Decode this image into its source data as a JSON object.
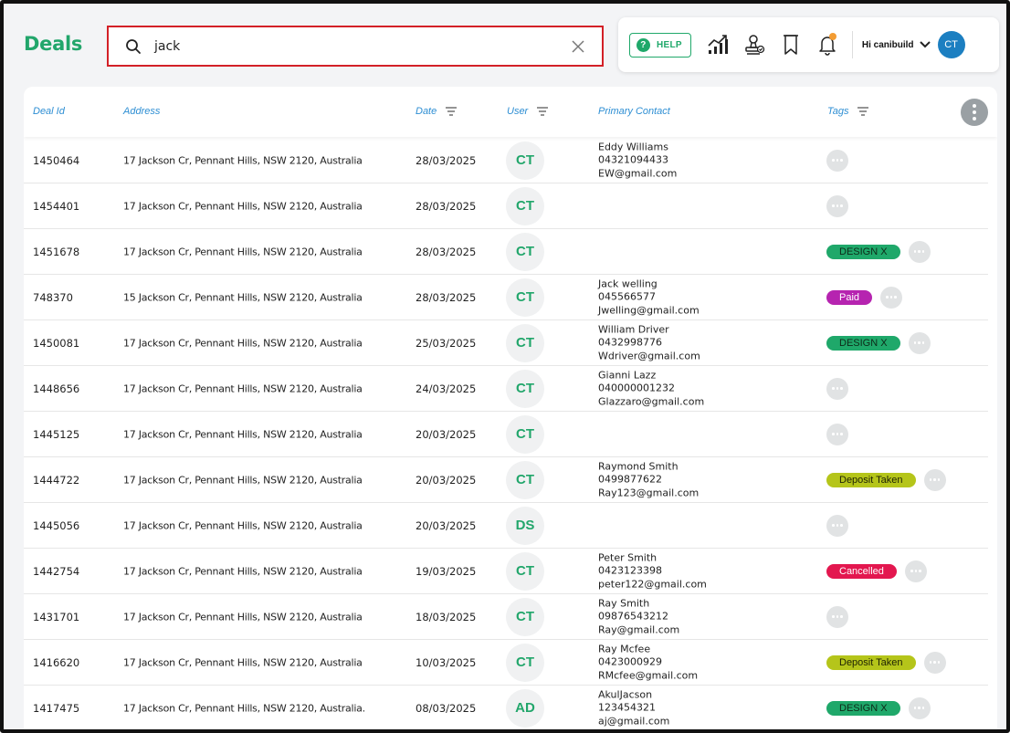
{
  "header": {
    "title": "Deals",
    "search_value": "jack",
    "help_label": "HELP",
    "greeting": "Hi canibuild",
    "user_initials": "CT"
  },
  "colors": {
    "brand_green": "#22a66b",
    "link_blue": "#2d8ed3",
    "search_border": "#d32027",
    "avatar_blue": "#1c7fc1",
    "notification_dot": "#f39c33"
  },
  "icons": {
    "search": "search-icon",
    "clear": "close-icon",
    "analytics": "chart-icon",
    "approvals": "stamp-icon",
    "bookmark": "bookmark-icon",
    "notifications": "bell-icon",
    "menu": "chevron-down-icon"
  },
  "table": {
    "columns": {
      "deal_id": "Deal Id",
      "address": "Address",
      "date": "Date",
      "user": "User",
      "primary_contact": "Primary Contact",
      "tags": "Tags"
    },
    "rows": [
      {
        "id": "1450464",
        "address": "17 Jackson Cr, Pennant Hills, NSW 2120, Australia",
        "date": "28/03/2025",
        "user": "CT",
        "contact": [
          "Eddy Williams",
          "04321094433",
          "EW@gmail.com"
        ],
        "tags": []
      },
      {
        "id": "1454401",
        "address": "17 Jackson Cr, Pennant Hills, NSW 2120, Australia",
        "date": "28/03/2025",
        "user": "CT",
        "contact": [
          "",
          "",
          ""
        ],
        "tags": []
      },
      {
        "id": "1451678",
        "address": "17 Jackson Cr, Pennant Hills, NSW 2120, Australia",
        "date": "28/03/2025",
        "user": "CT",
        "contact": [
          "",
          "",
          ""
        ],
        "tags": [
          {
            "label": "DESIGN X",
            "bg": "#1fa86a",
            "fg": "#0d2a18"
          }
        ]
      },
      {
        "id": "748370",
        "address": "15 Jackson Cr, Pennant Hills, NSW 2120, Australia",
        "date": "28/03/2025",
        "user": "CT",
        "contact": [
          "Jack welling",
          "045566577",
          "Jwelling@gmail.com"
        ],
        "tags": [
          {
            "label": "Paid",
            "bg": "#b624b0",
            "fg": "#ffffff"
          }
        ]
      },
      {
        "id": "1450081",
        "address": "17 Jackson Cr, Pennant Hills, NSW 2120, Australia",
        "date": "25/03/2025",
        "user": "CT",
        "contact": [
          "William Driver",
          "0432998776",
          "Wdriver@gmail.com"
        ],
        "tags": [
          {
            "label": "DESIGN X",
            "bg": "#1fa86a",
            "fg": "#0d2a18"
          }
        ]
      },
      {
        "id": "1448656",
        "address": "17 Jackson Cr, Pennant Hills, NSW 2120, Australia",
        "date": "24/03/2025",
        "user": "CT",
        "contact": [
          "Gianni Lazz",
          "040000001232",
          "Glazzaro@gmail.com"
        ],
        "tags": []
      },
      {
        "id": "1445125",
        "address": "17 Jackson Cr, Pennant Hills, NSW 2120, Australia",
        "date": "20/03/2025",
        "user": "CT",
        "contact": [
          "",
          "",
          ""
        ],
        "tags": []
      },
      {
        "id": "1444722",
        "address": "17 Jackson Cr, Pennant Hills, NSW 2120, Australia",
        "date": "20/03/2025",
        "user": "CT",
        "contact": [
          "Raymond Smith",
          "0499877622",
          "Ray123@gmail.com"
        ],
        "tags": [
          {
            "label": "Deposit Taken",
            "bg": "#b5c51a",
            "fg": "#1e2204"
          }
        ]
      },
      {
        "id": "1445056",
        "address": "17 Jackson Cr, Pennant Hills, NSW 2120, Australia",
        "date": "20/03/2025",
        "user": "DS",
        "contact": [
          "",
          "",
          ""
        ],
        "tags": []
      },
      {
        "id": "1442754",
        "address": "17 Jackson Cr, Pennant Hills, NSW 2120, Australia",
        "date": "19/03/2025",
        "user": "CT",
        "contact": [
          "Peter Smith",
          "0423123398",
          "peter122@gmail.com"
        ],
        "tags": [
          {
            "label": "Cancelled",
            "bg": "#e3174f",
            "fg": "#ffffff"
          }
        ]
      },
      {
        "id": "1431701",
        "address": "17 Jackson Cr, Pennant Hills, NSW 2120, Australia",
        "date": "18/03/2025",
        "user": "CT",
        "contact": [
          "Ray Smith",
          "09876543212",
          "Ray@gmail.com"
        ],
        "tags": []
      },
      {
        "id": "1416620",
        "address": "17 Jackson Cr, Pennant Hills, NSW 2120, Australia",
        "date": "10/03/2025",
        "user": "CT",
        "contact": [
          "Ray Mcfee",
          "0423000929",
          "RMcfee@gmail.com"
        ],
        "tags": [
          {
            "label": "Deposit Taken",
            "bg": "#b5c51a",
            "fg": "#1e2204"
          }
        ]
      },
      {
        "id": "1417475",
        "address": "17 Jackson Cr, Pennant Hills, NSW 2120, Australia.",
        "date": "08/03/2025",
        "user": "AD",
        "contact": [
          "AkulJacson",
          "123454321",
          "aj@gmail.com"
        ],
        "tags": [
          {
            "label": "DESIGN X",
            "bg": "#1fa86a",
            "fg": "#0d2a18"
          }
        ]
      }
    ]
  }
}
